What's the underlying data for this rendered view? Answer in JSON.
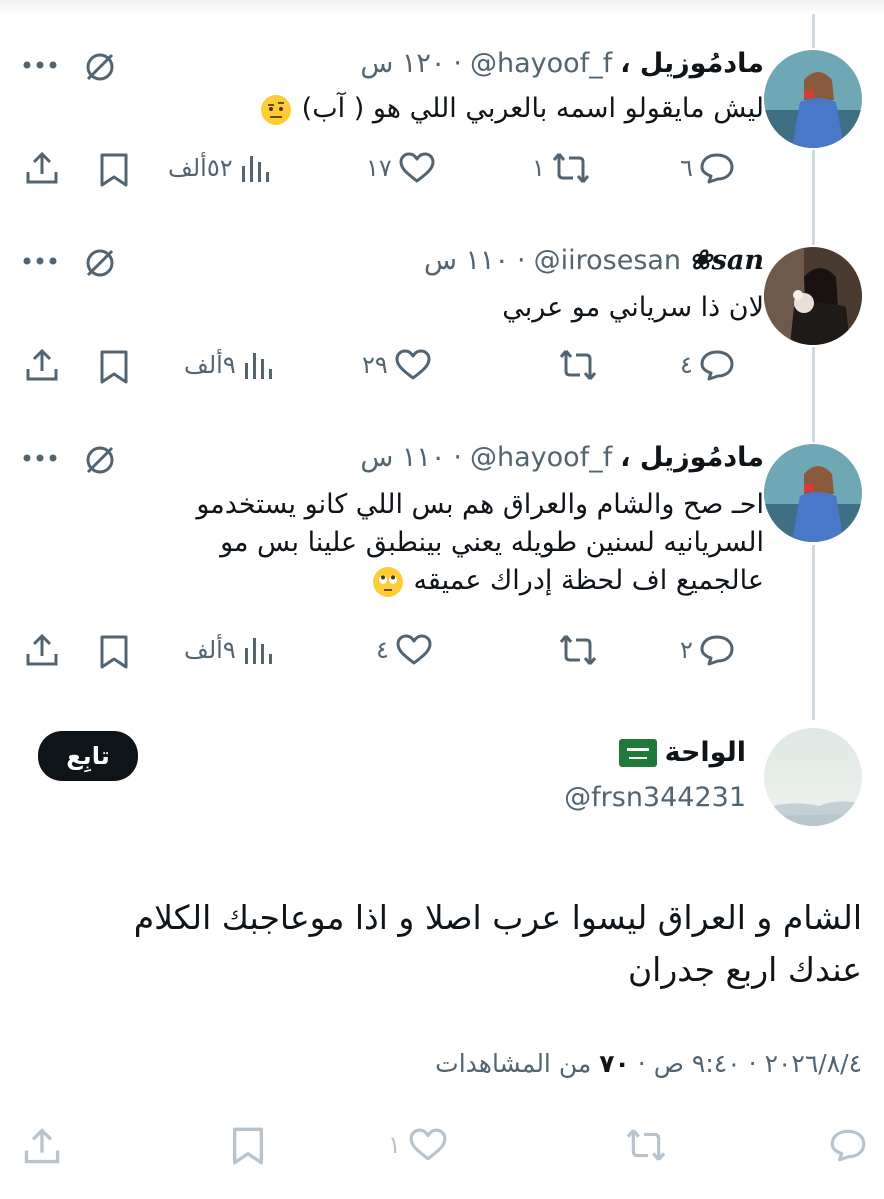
{
  "replies": [
    {
      "name": "مادمُوزيل ،",
      "handle": "@hayoof_f",
      "time": "١٢٠ س",
      "text": "ليش مايقولو اسمه بالعربي اللي هو ( آب)",
      "emoji": "face-with-raised-eyebrow",
      "replies": "٦",
      "retweets": "١",
      "likes": "١٧",
      "views": "٥٢ألف"
    },
    {
      "name": "san❀",
      "handle": "@iirosesan",
      "time": "١١٠ س",
      "text": "لان ذا سرياني مو عربي",
      "replies": "٤",
      "retweets": "",
      "likes": "٢٩",
      "views": "٩ألف"
    },
    {
      "name": "مادمُوزيل ،",
      "handle": "@hayoof_f",
      "time": "١١٠ س",
      "lines": [
        "احـ صح والشام والعراق هم بس اللي كانو يستخدمو",
        "السريانيه لسنين طويله يعني بينطبق علينا بس مو",
        "عالجميع اف لحظة إدراك عميقه"
      ],
      "emoji": "face-with-rolling-eyes",
      "replies": "٢",
      "retweets": "",
      "likes": "٤",
      "views": "٩ألف"
    }
  ],
  "main": {
    "name": "الواحة",
    "flag": "saudi-flag",
    "handle": "@frsn344231",
    "follow": "تابِع",
    "text_lines": [
      "الشام و العراق  ليسوا عرب اصلا  و اذا موعاجبك الكلام",
      "عندك اربع جدران"
    ],
    "date": "٢٠٢٦/٨/٤",
    "time": "٩:٤٠ ص",
    "views_count": "٧٠",
    "views_label": "من المشاهدات",
    "replies": "",
    "retweets": "",
    "likes": "١",
    "bookmarks": ""
  },
  "icons": [
    "more-icon",
    "grok-icon",
    "reply-icon",
    "retweet-icon",
    "like-icon",
    "views-icon",
    "bookmark-icon",
    "share-icon"
  ],
  "colors": {
    "text": "#0f1419",
    "muted": "#536471",
    "line": "#cfd9de",
    "faded": "#b9c3cb"
  }
}
